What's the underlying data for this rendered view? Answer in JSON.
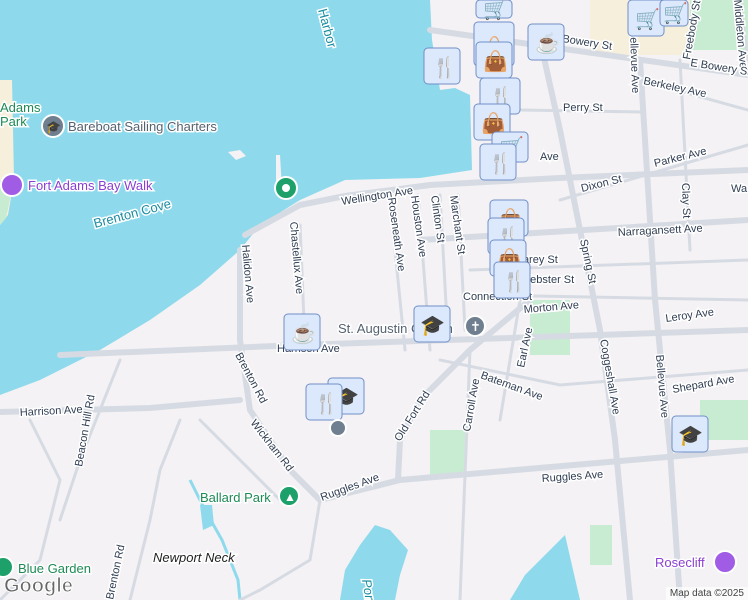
{
  "colors": {
    "water": "#8edaec",
    "land": "#f4f2f4",
    "park": "#c8ecd2",
    "road": "#d6dbe3",
    "poi_purple": "#8a3fd1",
    "poi_green": "#1e8a55",
    "water_label": "#1a8ca0"
  },
  "pois": {
    "fort_adams_park_line1": "Adams",
    "fort_adams_park_line2": "Park",
    "bareboat": "Bareboat Sailing Charters",
    "bay_walk": "Fort Adams Bay Walk",
    "brenton_cove": "Brenton Cove",
    "church": "St. Augustin Church",
    "ballard_park": "Ballard Park",
    "newport_neck": "Newport Neck",
    "blue_garden": "Blue Garden",
    "rosecliff": "Rosecliff",
    "pond": "Pond",
    "harbor": "Harbor"
  },
  "streets": {
    "wellington": "Wellington Ave",
    "chastellux": "Chastellux Ave",
    "halidon": "Halidon Ave",
    "roseneath": "Roseneath Ave",
    "houston": "Houston Ave",
    "clinton": "Clinton St",
    "marchant": "Marchant St",
    "spring": "Spring St",
    "bellevue_n": "Bellevue Ave",
    "freebody": "Freebody St",
    "middleton": "Middleton Ave",
    "bowery": "Bowery St",
    "e_bowery": "E Bowery St",
    "berkeley": "Berkeley Ave",
    "perry": "Perry St",
    "parker": "Parker Ave",
    "dixon": "Dixon St",
    "clay": "Clay St",
    "narragansett": "Narragansett Ave",
    "wa": "Wa",
    "carey": "Carey St",
    "webster": "Webster St",
    "connection": "Connection St",
    "morton": "Morton Ave",
    "leroy": "Leroy Ave",
    "harrison_e": "Harrison Ave",
    "harrison_w": "Harrison Ave",
    "bateman": "Bateman Ave",
    "shepard": "Shepard Ave",
    "earl": "Earl Ave",
    "carroll": "Carroll Ave",
    "old_fort": "Old Fort Rd",
    "coggeshall": "Coggeshall Ave",
    "bellevue_s": "Bellevue Ave",
    "brenton_n": "Brenton Rd",
    "beacon_hill": "Beacon Hill Rd",
    "wickham": "Wickham Rd",
    "ruggles_w": "Ruggles Ave",
    "ruggles_e": "Ruggles Ave",
    "brenton_s": "Brenton Rd",
    "ave": "Ave"
  },
  "footer": {
    "attribution": "Map data ©2025",
    "logo": "Google"
  }
}
